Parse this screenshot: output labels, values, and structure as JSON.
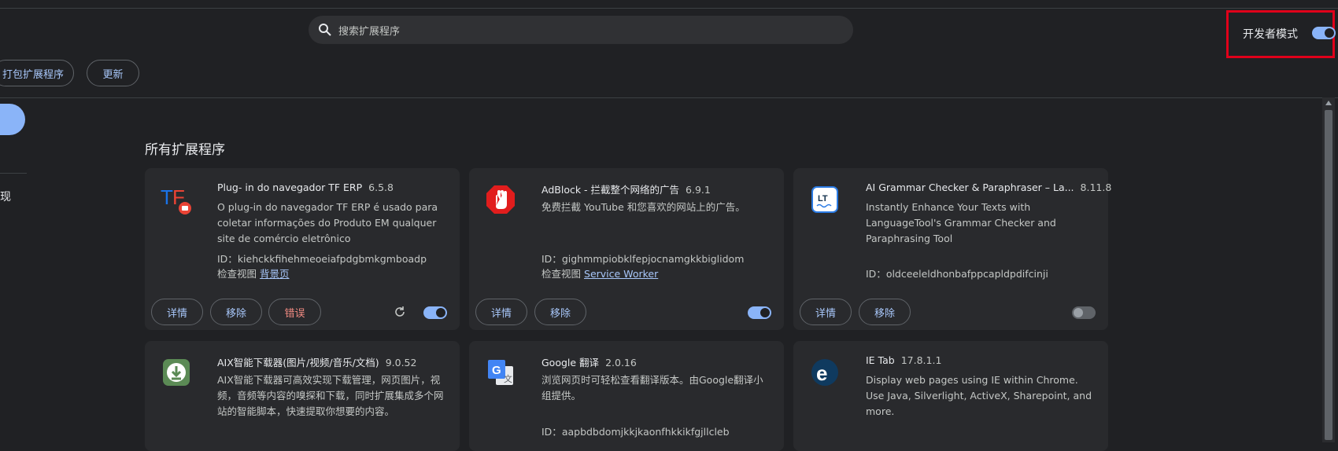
{
  "search": {
    "placeholder": "搜索扩展程序"
  },
  "developer_mode": {
    "label": "开发者模式",
    "enabled": true
  },
  "toolbar": {
    "pack_label": "打包扩展程序",
    "update_label": "更新"
  },
  "sidebar": {
    "item_label": "现"
  },
  "section_title": "所有扩展程序",
  "labels": {
    "id_prefix": "ID：",
    "inspect_prefix": "检查视图",
    "details": "详情",
    "remove": "移除",
    "errors": "错误"
  },
  "extensions": [
    {
      "name": "Plug- in do navegador TF ERP",
      "version": "6.5.8",
      "description": "O plug-in do navegador TF ERP é usado para coletar informações do Produto EM qualquer site de comércio eletrônico transfronteiriço.Você Pode",
      "id": "kiehckkfihehmeoeiafpdgbmkgmboadp",
      "inspect_link": "背景页",
      "enabled": true,
      "icon": "tf-erp-logo"
    },
    {
      "name": "AdBlock - 拦截整个网络的广告",
      "version": "6.9.1",
      "description": "免费拦截 YouTube 和您喜欢的网站上的广告。",
      "id": "gighmmpiobklfepjocnamgkkbiglidom",
      "inspect_link": "Service Worker",
      "enabled": true,
      "icon": "adblock-hand-icon"
    },
    {
      "name": "AI Grammar Checker & Paraphraser – La...",
      "version": "8.11.8",
      "description": "Instantly Enhance Your Texts with LanguageTool's Grammar Checker and Paraphrasing Tool",
      "id": "oldceeleldhonbafppcapldpdifcinji",
      "enabled": false,
      "icon": "languagetool-icon"
    },
    {
      "name": "AIX智能下载器(图片/视频/音乐/文档)",
      "version": "9.0.52",
      "description": "AIX智能下载器可高效实现下载管理，网页图片，视频，音频等内容的嗅探和下载，同时扩展集成多个网站的智能脚本，快速提取你想要的内容。",
      "icon": "download-icon"
    },
    {
      "name": "Google 翻译",
      "version": "2.0.16",
      "description": "浏览网页时可轻松查看翻译版本。由Google翻译小组提供。",
      "id": "aapbdbdomjkkjkaonfhkkikfgjllcleb",
      "icon": "google-translate-icon"
    },
    {
      "name": "IE Tab",
      "version": "17.8.1.1",
      "description": "Display web pages using IE within Chrome. Use Java, Silverlight, ActiveX, Sharepoint, and more.",
      "icon": "ie-tab-icon"
    }
  ],
  "colors": {
    "background": "#202124",
    "card": "#292a2d",
    "accent": "#8ab4f8",
    "highlight_border": "#e0001a",
    "error": "#f28b82"
  }
}
